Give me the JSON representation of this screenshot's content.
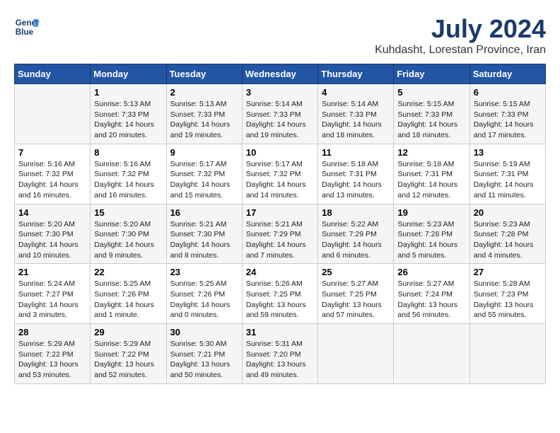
{
  "logo": {
    "line1": "General",
    "line2": "Blue"
  },
  "title": "July 2024",
  "subtitle": "Kuhdasht, Lorestan Province, Iran",
  "days_of_week": [
    "Sunday",
    "Monday",
    "Tuesday",
    "Wednesday",
    "Thursday",
    "Friday",
    "Saturday"
  ],
  "weeks": [
    [
      {
        "day": "",
        "info": ""
      },
      {
        "day": "1",
        "info": "Sunrise: 5:13 AM\nSunset: 7:33 PM\nDaylight: 14 hours\nand 20 minutes."
      },
      {
        "day": "2",
        "info": "Sunrise: 5:13 AM\nSunset: 7:33 PM\nDaylight: 14 hours\nand 19 minutes."
      },
      {
        "day": "3",
        "info": "Sunrise: 5:14 AM\nSunset: 7:33 PM\nDaylight: 14 hours\nand 19 minutes."
      },
      {
        "day": "4",
        "info": "Sunrise: 5:14 AM\nSunset: 7:33 PM\nDaylight: 14 hours\nand 18 minutes."
      },
      {
        "day": "5",
        "info": "Sunrise: 5:15 AM\nSunset: 7:33 PM\nDaylight: 14 hours\nand 18 minutes."
      },
      {
        "day": "6",
        "info": "Sunrise: 5:15 AM\nSunset: 7:33 PM\nDaylight: 14 hours\nand 17 minutes."
      }
    ],
    [
      {
        "day": "7",
        "info": "Sunrise: 5:16 AM\nSunset: 7:32 PM\nDaylight: 14 hours\nand 16 minutes."
      },
      {
        "day": "8",
        "info": "Sunrise: 5:16 AM\nSunset: 7:32 PM\nDaylight: 14 hours\nand 16 minutes."
      },
      {
        "day": "9",
        "info": "Sunrise: 5:17 AM\nSunset: 7:32 PM\nDaylight: 14 hours\nand 15 minutes."
      },
      {
        "day": "10",
        "info": "Sunrise: 5:17 AM\nSunset: 7:32 PM\nDaylight: 14 hours\nand 14 minutes."
      },
      {
        "day": "11",
        "info": "Sunrise: 5:18 AM\nSunset: 7:31 PM\nDaylight: 14 hours\nand 13 minutes."
      },
      {
        "day": "12",
        "info": "Sunrise: 5:18 AM\nSunset: 7:31 PM\nDaylight: 14 hours\nand 12 minutes."
      },
      {
        "day": "13",
        "info": "Sunrise: 5:19 AM\nSunset: 7:31 PM\nDaylight: 14 hours\nand 11 minutes."
      }
    ],
    [
      {
        "day": "14",
        "info": "Sunrise: 5:20 AM\nSunset: 7:30 PM\nDaylight: 14 hours\nand 10 minutes."
      },
      {
        "day": "15",
        "info": "Sunrise: 5:20 AM\nSunset: 7:30 PM\nDaylight: 14 hours\nand 9 minutes."
      },
      {
        "day": "16",
        "info": "Sunrise: 5:21 AM\nSunset: 7:30 PM\nDaylight: 14 hours\nand 8 minutes."
      },
      {
        "day": "17",
        "info": "Sunrise: 5:21 AM\nSunset: 7:29 PM\nDaylight: 14 hours\nand 7 minutes."
      },
      {
        "day": "18",
        "info": "Sunrise: 5:22 AM\nSunset: 7:29 PM\nDaylight: 14 hours\nand 6 minutes."
      },
      {
        "day": "19",
        "info": "Sunrise: 5:23 AM\nSunset: 7:28 PM\nDaylight: 14 hours\nand 5 minutes."
      },
      {
        "day": "20",
        "info": "Sunrise: 5:23 AM\nSunset: 7:28 PM\nDaylight: 14 hours\nand 4 minutes."
      }
    ],
    [
      {
        "day": "21",
        "info": "Sunrise: 5:24 AM\nSunset: 7:27 PM\nDaylight: 14 hours\nand 3 minutes."
      },
      {
        "day": "22",
        "info": "Sunrise: 5:25 AM\nSunset: 7:26 PM\nDaylight: 14 hours\nand 1 minute."
      },
      {
        "day": "23",
        "info": "Sunrise: 5:25 AM\nSunset: 7:26 PM\nDaylight: 14 hours\nand 0 minutes."
      },
      {
        "day": "24",
        "info": "Sunrise: 5:26 AM\nSunset: 7:25 PM\nDaylight: 13 hours\nand 59 minutes."
      },
      {
        "day": "25",
        "info": "Sunrise: 5:27 AM\nSunset: 7:25 PM\nDaylight: 13 hours\nand 57 minutes."
      },
      {
        "day": "26",
        "info": "Sunrise: 5:27 AM\nSunset: 7:24 PM\nDaylight: 13 hours\nand 56 minutes."
      },
      {
        "day": "27",
        "info": "Sunrise: 5:28 AM\nSunset: 7:23 PM\nDaylight: 13 hours\nand 55 minutes."
      }
    ],
    [
      {
        "day": "28",
        "info": "Sunrise: 5:29 AM\nSunset: 7:22 PM\nDaylight: 13 hours\nand 53 minutes."
      },
      {
        "day": "29",
        "info": "Sunrise: 5:29 AM\nSunset: 7:22 PM\nDaylight: 13 hours\nand 52 minutes."
      },
      {
        "day": "30",
        "info": "Sunrise: 5:30 AM\nSunset: 7:21 PM\nDaylight: 13 hours\nand 50 minutes."
      },
      {
        "day": "31",
        "info": "Sunrise: 5:31 AM\nSunset: 7:20 PM\nDaylight: 13 hours\nand 49 minutes."
      },
      {
        "day": "",
        "info": ""
      },
      {
        "day": "",
        "info": ""
      },
      {
        "day": "",
        "info": ""
      }
    ]
  ]
}
